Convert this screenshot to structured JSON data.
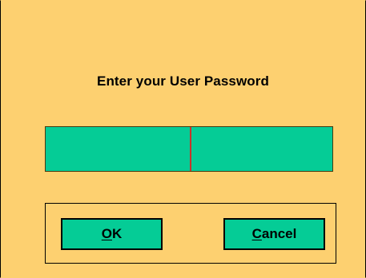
{
  "dialog": {
    "prompt": "Enter your User Password",
    "password_value": ""
  },
  "buttons": {
    "ok": {
      "mnemonic": "O",
      "rest": "K"
    },
    "cancel": {
      "mnemonic": "C",
      "rest": "ancel"
    }
  },
  "colors": {
    "background": "#fdd070",
    "field": "#05cc96",
    "caret": "#c8352b",
    "border": "#000000"
  }
}
